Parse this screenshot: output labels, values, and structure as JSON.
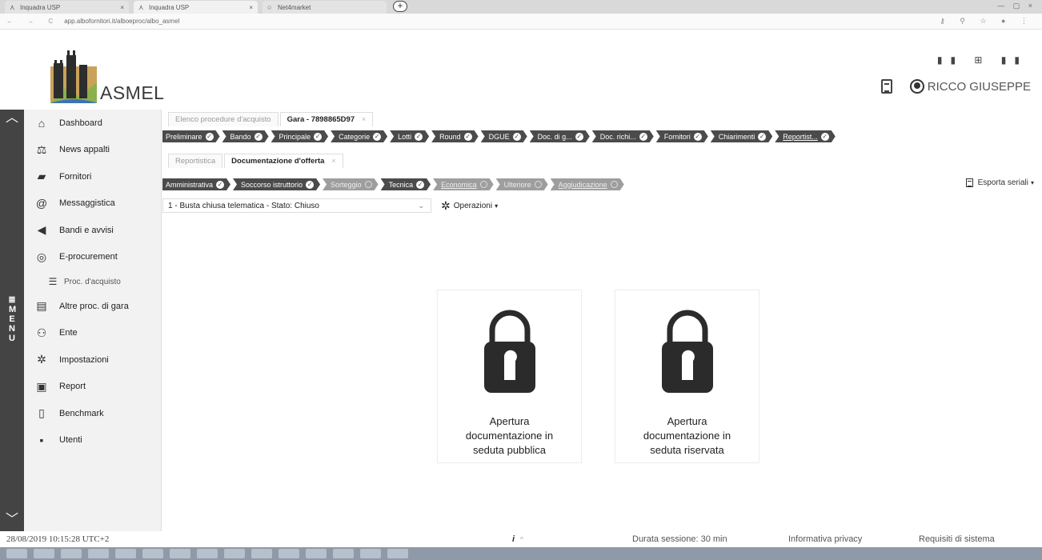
{
  "browser": {
    "tabs": [
      {
        "title": "Inquadra USP",
        "active": false
      },
      {
        "title": "Inquadra USP",
        "active": true
      },
      {
        "title": "Net4market",
        "active": false
      }
    ],
    "url": "app.albofornitori.it/alboeproc/albo_asmel"
  },
  "header": {
    "logo_text": "ASMEL",
    "user_name": "RICCO GIUSEPPE"
  },
  "sidebar": {
    "menu_label": "MENU",
    "items": [
      {
        "label": "Dashboard",
        "icon": "home-icon"
      },
      {
        "label": "News appalti",
        "icon": "scale-icon"
      },
      {
        "label": "Fornitori",
        "icon": "truck-icon"
      },
      {
        "label": "Messaggistica",
        "icon": "at-icon"
      },
      {
        "label": "Bandi e avvisi",
        "icon": "megaphone-icon"
      },
      {
        "label": "E-procurement",
        "icon": "coins-icon"
      },
      {
        "label": "Proc. d'acquisto",
        "icon": "list-icon",
        "sub": true
      },
      {
        "label": "Altre proc. di gara",
        "icon": "books-icon"
      },
      {
        "label": "Ente",
        "icon": "people-icon"
      },
      {
        "label": "Impostazioni",
        "icon": "gear-icon"
      },
      {
        "label": "Report",
        "icon": "presentation-icon"
      },
      {
        "label": "Benchmark",
        "icon": "document-icon"
      },
      {
        "label": "Utenti",
        "icon": "user-card-icon"
      }
    ]
  },
  "tabs": [
    {
      "label": "Elenco procedure d'acquisto",
      "active": false
    },
    {
      "label": "Gara - 7898865D97",
      "active": true,
      "close": "×"
    }
  ],
  "steps": [
    {
      "label": "Preliminare",
      "done": true
    },
    {
      "label": "Bando",
      "done": true
    },
    {
      "label": "Principale",
      "done": true
    },
    {
      "label": "Categorie",
      "done": true
    },
    {
      "label": "Lotti",
      "done": true
    },
    {
      "label": "Round",
      "done": true
    },
    {
      "label": "DGUE",
      "done": true
    },
    {
      "label": "Doc. di g...",
      "done": true
    },
    {
      "label": "Doc. richi...",
      "done": true
    },
    {
      "label": "Fornitori",
      "done": true
    },
    {
      "label": "Chiarimenti",
      "done": true
    },
    {
      "label": "Reportist...",
      "done": true
    }
  ],
  "subtabs": [
    {
      "label": "Reportistica",
      "active": false
    },
    {
      "label": "Documentazione d'offerta",
      "active": true,
      "close": "×"
    }
  ],
  "substeps": [
    {
      "label": "Amministrativa",
      "done": true
    },
    {
      "label": "Soccorso istruttorio",
      "done": true
    },
    {
      "label": "Sorteggio",
      "done": false
    },
    {
      "label": "Tecnica",
      "done": true
    },
    {
      "label": "Economica",
      "done": false
    },
    {
      "label": "Ulteriore",
      "done": false
    },
    {
      "label": "Aggiudicazione",
      "done": false
    }
  ],
  "export_label": "Esporta seriali",
  "busta": {
    "selected": "1 - Busta chiusa telematica - Stato: Chiuso",
    "operations_label": "Operazioni"
  },
  "cards": [
    {
      "label_lines": [
        "Apertura",
        "documentazione in",
        "seduta pubblica"
      ]
    },
    {
      "label_lines": [
        "Apertura",
        "documentazione in",
        "seduta riservata"
      ]
    }
  ],
  "footer": {
    "timestamp": "28/08/2019 10:15:28 UTC+2",
    "info": "i",
    "session": "Durata sessione: 30 min",
    "privacy": "Informativa privacy",
    "requirements": "Requisiti di sistema"
  }
}
